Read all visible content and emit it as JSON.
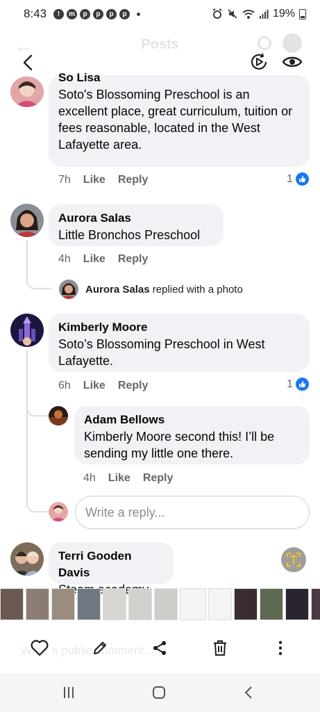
{
  "status_bar": {
    "time": "8:43",
    "notification_badges": [
      "!",
      "m",
      "p",
      "p",
      "p",
      "p"
    ],
    "battery": "19%"
  },
  "header": {
    "title": "Posts"
  },
  "comments": [
    {
      "author": "So Lisa",
      "text": "Soto's Blossoming Preschool is an excellent place, great curriculum, tuition or fees reasonable, located in the West Lafayette area.",
      "time": "7h",
      "like_label": "Like",
      "reply_label": "Reply",
      "reactions": "1"
    },
    {
      "author": "Aurora Salas",
      "text": "Little Bronchos Preschool",
      "time": "4h",
      "like_label": "Like",
      "reply_label": "Reply",
      "replied_summary": {
        "author": "Aurora Salas",
        "action": "replied with a photo"
      }
    },
    {
      "author": "Kimberly Moore",
      "text": "Soto’s Blossoming Preschool in West Lafayette.",
      "time": "6h",
      "like_label": "Like",
      "reply_label": "Reply",
      "reactions": "1",
      "reply": {
        "author": "Adam Bellows",
        "text": "Kimberly Moore second this! I’ll be sending my little one there.",
        "time": "4h",
        "like_label": "Like",
        "reply_label": "Reply"
      }
    },
    {
      "author": "Terri Gooden Davis",
      "text": "Steam academy"
    }
  ],
  "write_reply": {
    "placeholder": "Write a reply..."
  },
  "bottom_ghost_text": "Write a public comment...",
  "colors": {
    "bubble_bg": "#f0f2f5",
    "meta_text": "#65676b",
    "like_blue": "#1877f2",
    "t_button": "#9e9e9e",
    "t_button_glyph": "#f5c518"
  }
}
